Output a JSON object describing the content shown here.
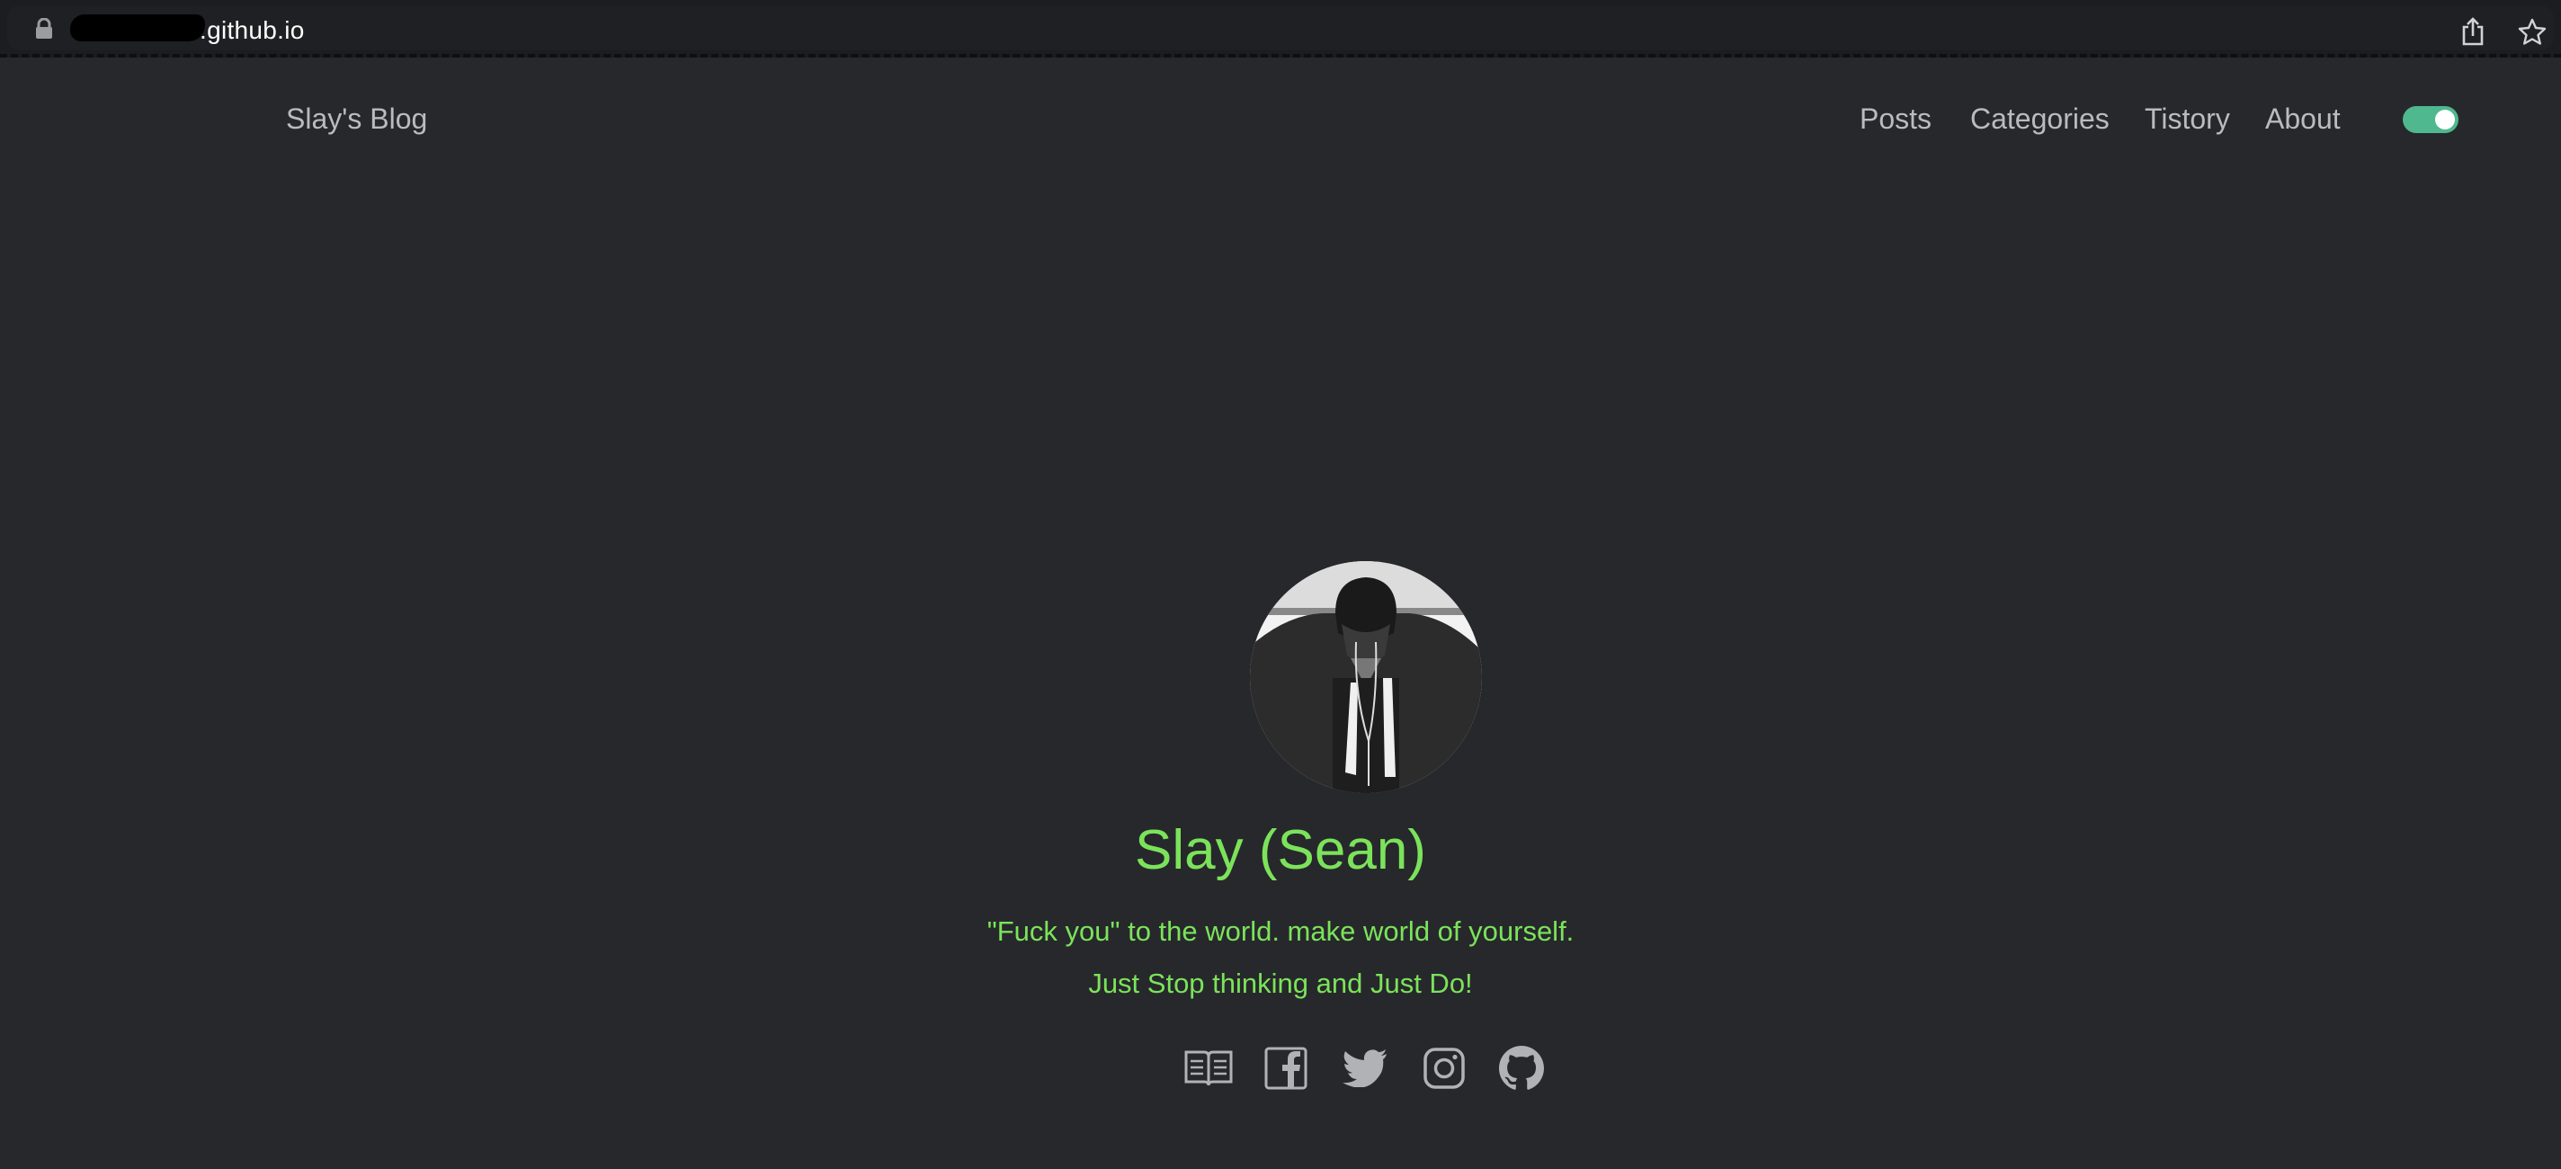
{
  "browser": {
    "url_visible": ".github.io"
  },
  "header": {
    "site_title": "Slay's Blog",
    "nav": [
      {
        "label": "Posts"
      },
      {
        "label": "Categories"
      },
      {
        "label": "Tistory"
      },
      {
        "label": "About"
      }
    ],
    "theme_toggle": {
      "state": "on",
      "color": "#4fb88f"
    }
  },
  "profile": {
    "name": "Slay (Sean)",
    "tagline_1": "\"Fuck you\" to the world. make world of yourself.",
    "tagline_2": "Just Stop thinking and Just Do!",
    "accent_color": "#7be35a"
  },
  "socials": [
    {
      "icon": "book-icon"
    },
    {
      "icon": "facebook-icon"
    },
    {
      "icon": "twitter-icon"
    },
    {
      "icon": "instagram-icon"
    },
    {
      "icon": "github-icon"
    }
  ]
}
